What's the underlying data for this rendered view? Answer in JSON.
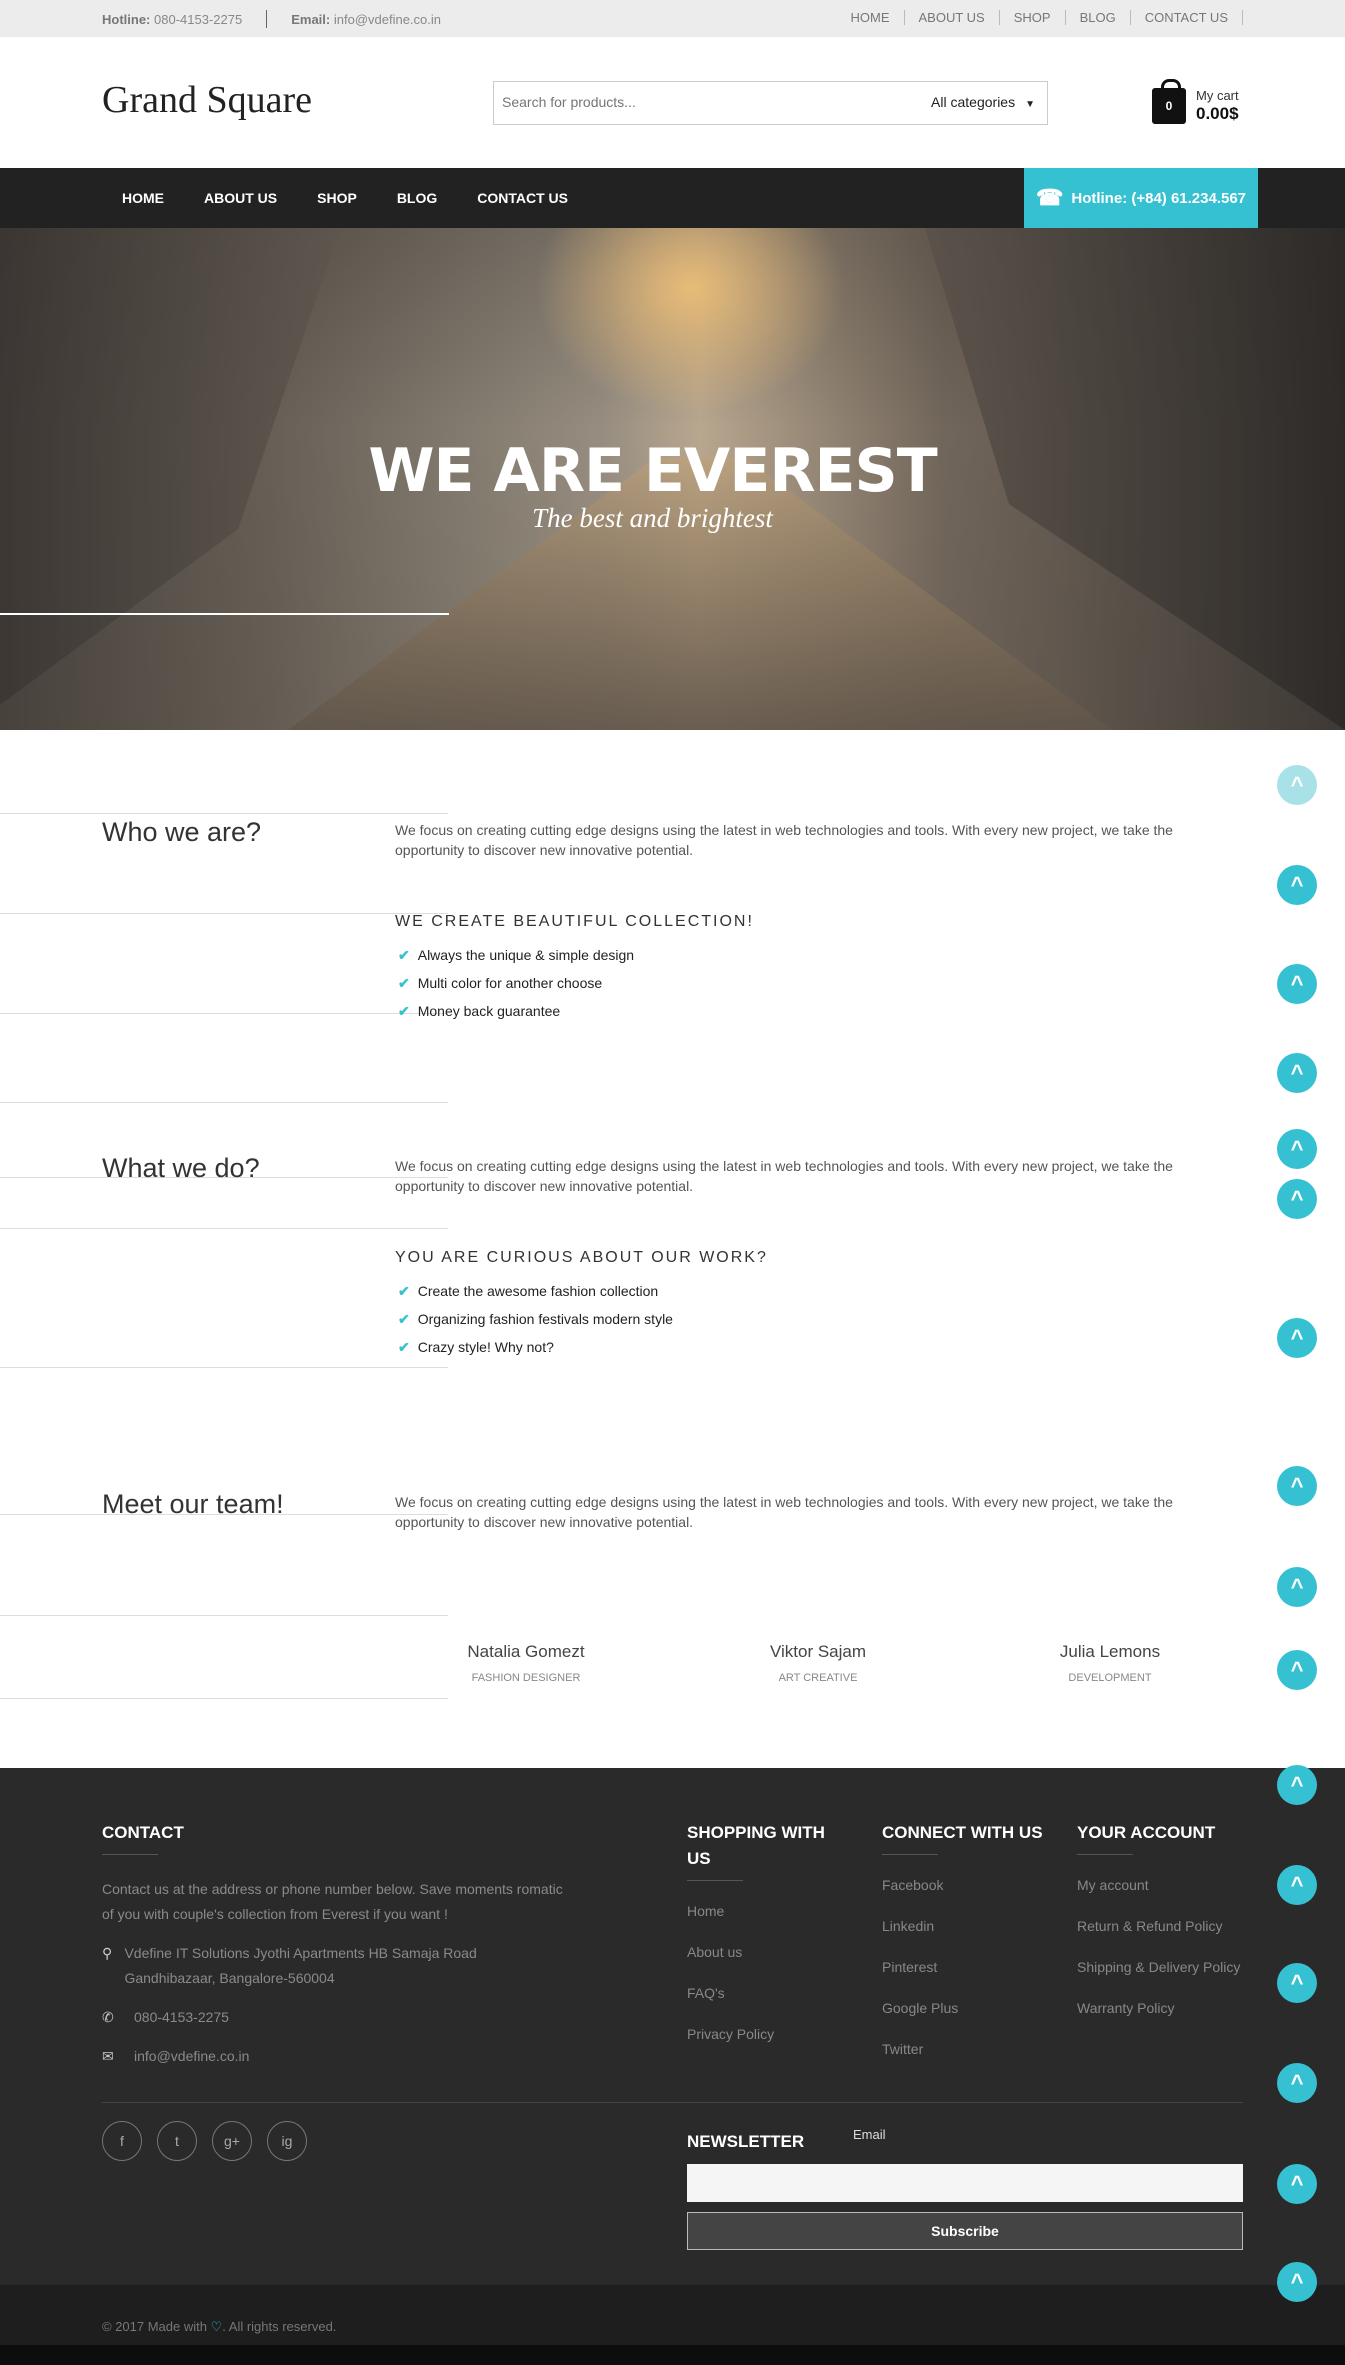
{
  "topbar": {
    "hotline_label": "Hotline:",
    "hotline_value": "080-4153-2275",
    "email_label": "Email:",
    "email_value": "info@vdefine.co.in",
    "links": [
      "HOME",
      "ABOUT US",
      "SHOP",
      "BLOG",
      "CONTACT US"
    ]
  },
  "header": {
    "logo": "Grand Square",
    "search_placeholder": "Search for products...",
    "category": "All categories",
    "cart_count": "0",
    "cart_label": "My cart",
    "cart_total": "0.00$"
  },
  "nav": {
    "items": [
      "HOME",
      "ABOUT US",
      "SHOP",
      "BLOG",
      "CONTACT US"
    ],
    "hotline": "Hotline: (+84) 61.234.567"
  },
  "hero": {
    "title": "WE ARE EVEREST",
    "tagline": "The best and brightest"
  },
  "sections": {
    "who": {
      "title": "Who we are?",
      "text": "We focus on creating cutting edge designs using the latest in web technologies and tools. With every new project, we take the opportunity to discover new innovative potential.",
      "subtitle": "WE CREATE BEAUTIFUL COLLECTION!",
      "items": [
        "Always the unique & simple design",
        "Multi color for another choose",
        "Money back guarantee"
      ]
    },
    "what": {
      "title": "What we do?",
      "text": "We focus on creating cutting edge designs using the latest in web technologies and tools. With every new project, we take the opportunity to discover new innovative potential.",
      "subtitle": "YOU ARE CURIOUS ABOUT OUR WORK?",
      "items": [
        "Create the awesome fashion collection",
        "Organizing fashion festivals modern style",
        "Crazy style! Why not?"
      ]
    },
    "team": {
      "title": "Meet our team!",
      "text": "We focus on creating cutting edge designs using the latest in web technologies and tools. With every new project, we take the opportunity to discover new innovative potential.",
      "members": [
        {
          "name": "Natalia Gomezt",
          "role": "FASHION DESIGNER"
        },
        {
          "name": "Viktor Sajam",
          "role": "ART CREATIVE"
        },
        {
          "name": "Julia Lemons",
          "role": "DEVELOPMENT"
        }
      ]
    }
  },
  "footer": {
    "contact": {
      "title": "CONTACT",
      "description": "Contact us at the address or phone number below. Save moments romatic of you with couple's collection from Everest if you want !",
      "address": "Vdefine IT Solutions Jyothi Apartments HB Samaja Road Gandhibazaar, Bangalore-560004",
      "phone": "080-4153-2275",
      "email": "info@vdefine.co.in"
    },
    "shopping": {
      "title": "SHOPPING WITH US",
      "links": [
        "Home",
        "About us",
        "FAQ's",
        "Privacy Policy"
      ]
    },
    "connect": {
      "title": "CONNECT WITH US",
      "links": [
        "Facebook",
        "Linkedin",
        "Pinterest",
        "Google Plus",
        "Twitter"
      ]
    },
    "account": {
      "title": "YOUR ACCOUNT",
      "links": [
        "My account",
        "Return & Refund Policy",
        "Shipping & Delivery Policy",
        "Warranty Policy"
      ]
    },
    "social_icons": [
      "f",
      "t",
      "g+",
      "ig"
    ],
    "newsletter": {
      "title": "NEWSLETTER",
      "email_label": "Email",
      "button": "Subscribe"
    },
    "copyright_prefix": "© 2017 Made with",
    "copyright_suffix": ". All rights reserved."
  },
  "icons": {
    "scroll_top": "^",
    "check": "✔",
    "phone": "☎",
    "pin": "📍",
    "tel": "📞",
    "mail": "✉",
    "heart": "♡"
  },
  "colors": {
    "accent": "#36c1d3",
    "nav_bg": "#222222",
    "footer_bg": "#2a2a2a"
  }
}
